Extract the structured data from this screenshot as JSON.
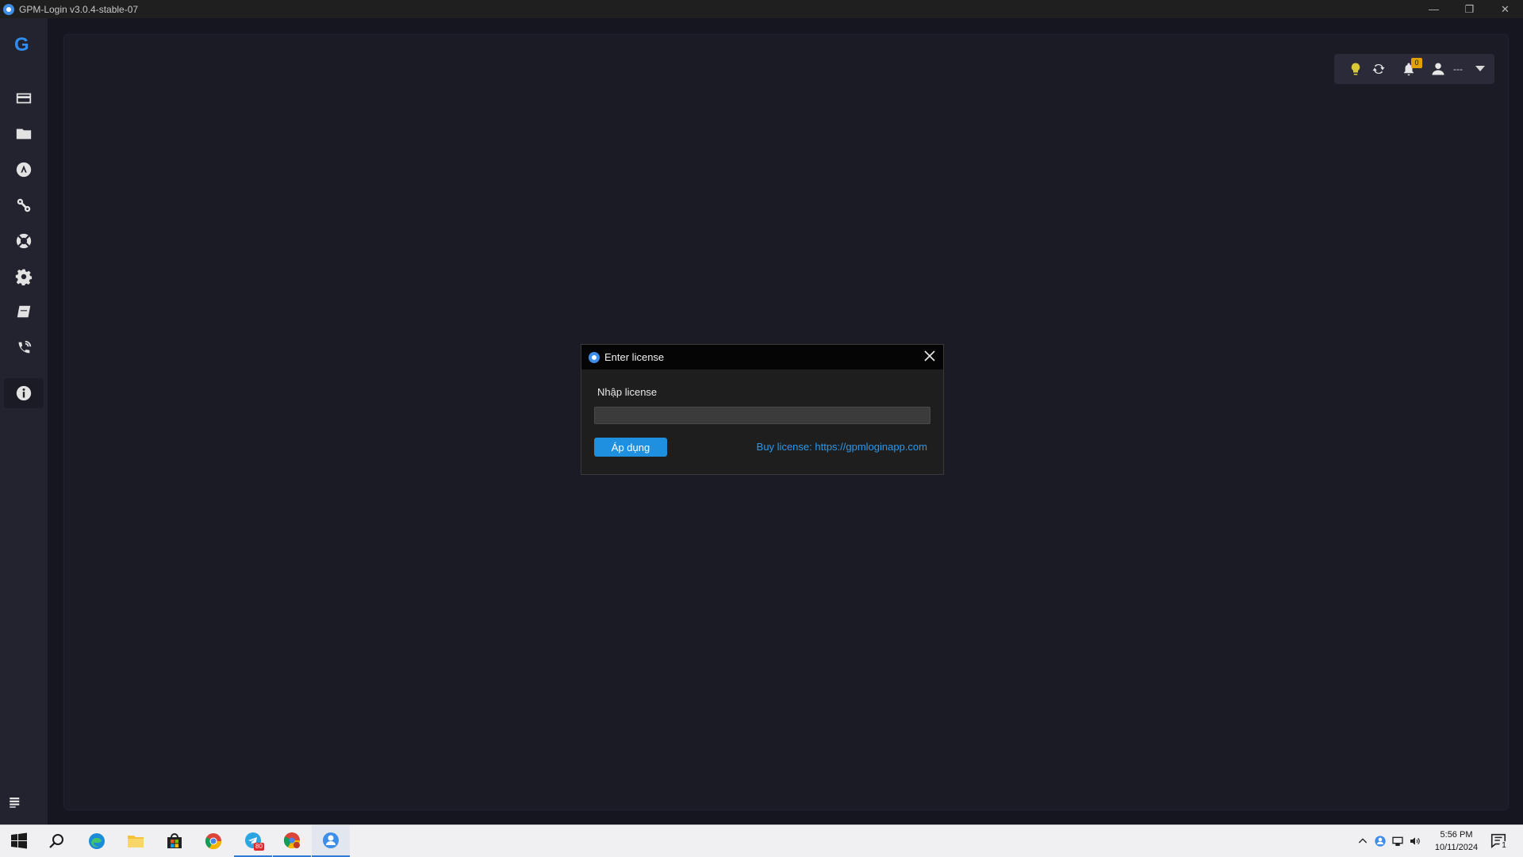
{
  "window": {
    "title": "GPM-Login v3.0.4-stable-07",
    "controls": {
      "minimize": "—",
      "restore": "❐",
      "close": "✕"
    }
  },
  "sidebar": {
    "logo": "G",
    "items": [
      {
        "name": "profiles-icon"
      },
      {
        "name": "folder-icon"
      },
      {
        "name": "extension-icon"
      },
      {
        "name": "proxy-icon"
      },
      {
        "name": "support-icon"
      },
      {
        "name": "settings-icon"
      },
      {
        "name": "docs-icon"
      },
      {
        "name": "contact-icon"
      },
      {
        "name": "info-icon",
        "active": true
      }
    ]
  },
  "toolbar": {
    "notification_count": "0",
    "user_name": "---"
  },
  "dialog": {
    "title": "Enter license",
    "label": "Nhập license",
    "input_value": "",
    "apply_label": "Áp dụng",
    "buy_link": "Buy license: https://gpmloginapp.com"
  },
  "taskbar": {
    "apps": [
      "start-icon",
      "search-icon",
      "edge-icon",
      "file-explorer-icon",
      "store-icon",
      "chrome-icon",
      "telegram-icon",
      "chrome-profile-icon",
      "gpm-login-icon"
    ],
    "telegram_badge": "80",
    "time": "5:56 PM",
    "date": "10/11/2024",
    "notification_count": "1"
  },
  "colors": {
    "accent": "#1f8fe0",
    "link": "#2b98ec",
    "background": "#1b1b26",
    "sidebar": "#23232f"
  }
}
